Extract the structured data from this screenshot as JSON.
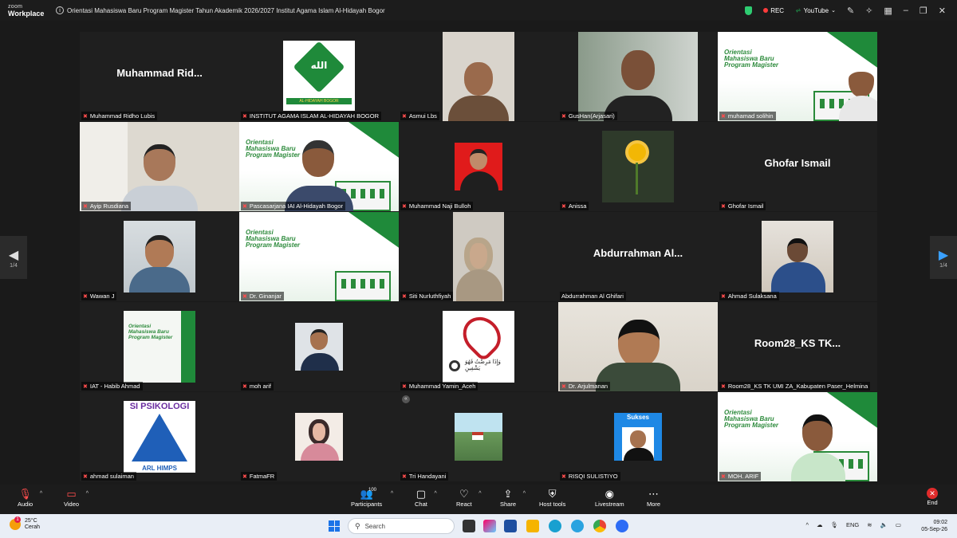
{
  "titlebar": {
    "logo_top": "zoom",
    "logo_bottom": "Workplace",
    "meeting_title": "Orientasi Mahasiswa Baru Program Magister Tahun Akademik 2026/2027 Institut Agama Islam Al-Hidayah Bogor",
    "rec_label": "REC",
    "youtube_label": "YouTube"
  },
  "colors": {
    "mic_muted": "#ff4d4d",
    "slide_green": "#1f8a3a",
    "end_red": "#e02b2b",
    "accent_blue": "#3aa0ff"
  },
  "tiles": [
    {
      "big": "Muhammad  Rid...",
      "name": "Muhammad Ridho Lubis"
    },
    {
      "big": "",
      "name": "INSTITUT AGAMA ISLAM AL-HIDAYAH BOGOR"
    },
    {
      "big": "",
      "name": "Asmui Lbs"
    },
    {
      "big": "",
      "name": "GusHan(Arjasari)"
    },
    {
      "big": "",
      "name": "muhamad solihin"
    },
    {
      "big": "",
      "name": "Ayip Rusdiana"
    },
    {
      "big": "",
      "name": "Pascasarjana IAI Al-Hidayah Bogor"
    },
    {
      "big": "",
      "name": "Muhammad Naji Bulloh"
    },
    {
      "big": "",
      "name": "Anissa"
    },
    {
      "big": "Ghofar Ismail",
      "name": "Ghofar Ismail"
    },
    {
      "big": "",
      "name": "Wawan J"
    },
    {
      "big": "",
      "name": "Dr. Ginanjar"
    },
    {
      "big": "",
      "name": "Siti Nurluthfiyah"
    },
    {
      "big": "Abdurrahman  Al...",
      "name": "Abdurrahman Al Ghifari"
    },
    {
      "big": "",
      "name": "Ahmad Sulaksana"
    },
    {
      "big": "",
      "name": "IAT - Habib Ahmad"
    },
    {
      "big": "",
      "name": "moh arif"
    },
    {
      "big": "",
      "name": "Muhammad Yamin_Aceh"
    },
    {
      "big": "",
      "name": "Dr. Arjulmanan"
    },
    {
      "big": "Room28_KS  TK...",
      "name": "Room28_KS TK UMI ZA_Kabupaten Paser_Helmina"
    },
    {
      "big": "",
      "name": "ahmad sulaiman"
    },
    {
      "big": "",
      "name": "FatmaFR"
    },
    {
      "big": "",
      "name": "Tri Handayani"
    },
    {
      "big": "",
      "name": "RISQI SULISTIYO"
    },
    {
      "big": "",
      "name": "MOH. ARIF"
    }
  ],
  "slide": {
    "title_line1": "Orientasi",
    "title_line2": "Mahasiswa Baru",
    "title_line3": "Program Magister"
  },
  "avatar_texts": {
    "iai_logo": "AL-HIDAYAH BOGOR",
    "psikologi": "SI PSIKOLOGI",
    "arl": "ARL HIMPS",
    "sukses": "Sukses",
    "arabic": "وَإِذَا مَرِضْتُ فَهُوَ يَشْفِينِ"
  },
  "pager": {
    "left_page": "1/4",
    "right_page": "1/4"
  },
  "toolbar": {
    "audio": "Audio",
    "video": "Video",
    "participants": "Participants",
    "participants_count": "100",
    "chat": "Chat",
    "react": "React",
    "share": "Share",
    "host_tools": "Host tools",
    "livestream": "Livestream",
    "more": "More",
    "end": "End"
  },
  "taskbar": {
    "temperature": "25°C",
    "condition": "Cerah",
    "weather_badge": "1",
    "search_placeholder": "Search",
    "lang": "ENG",
    "time": "09:02",
    "date": "05-Sep-26"
  }
}
